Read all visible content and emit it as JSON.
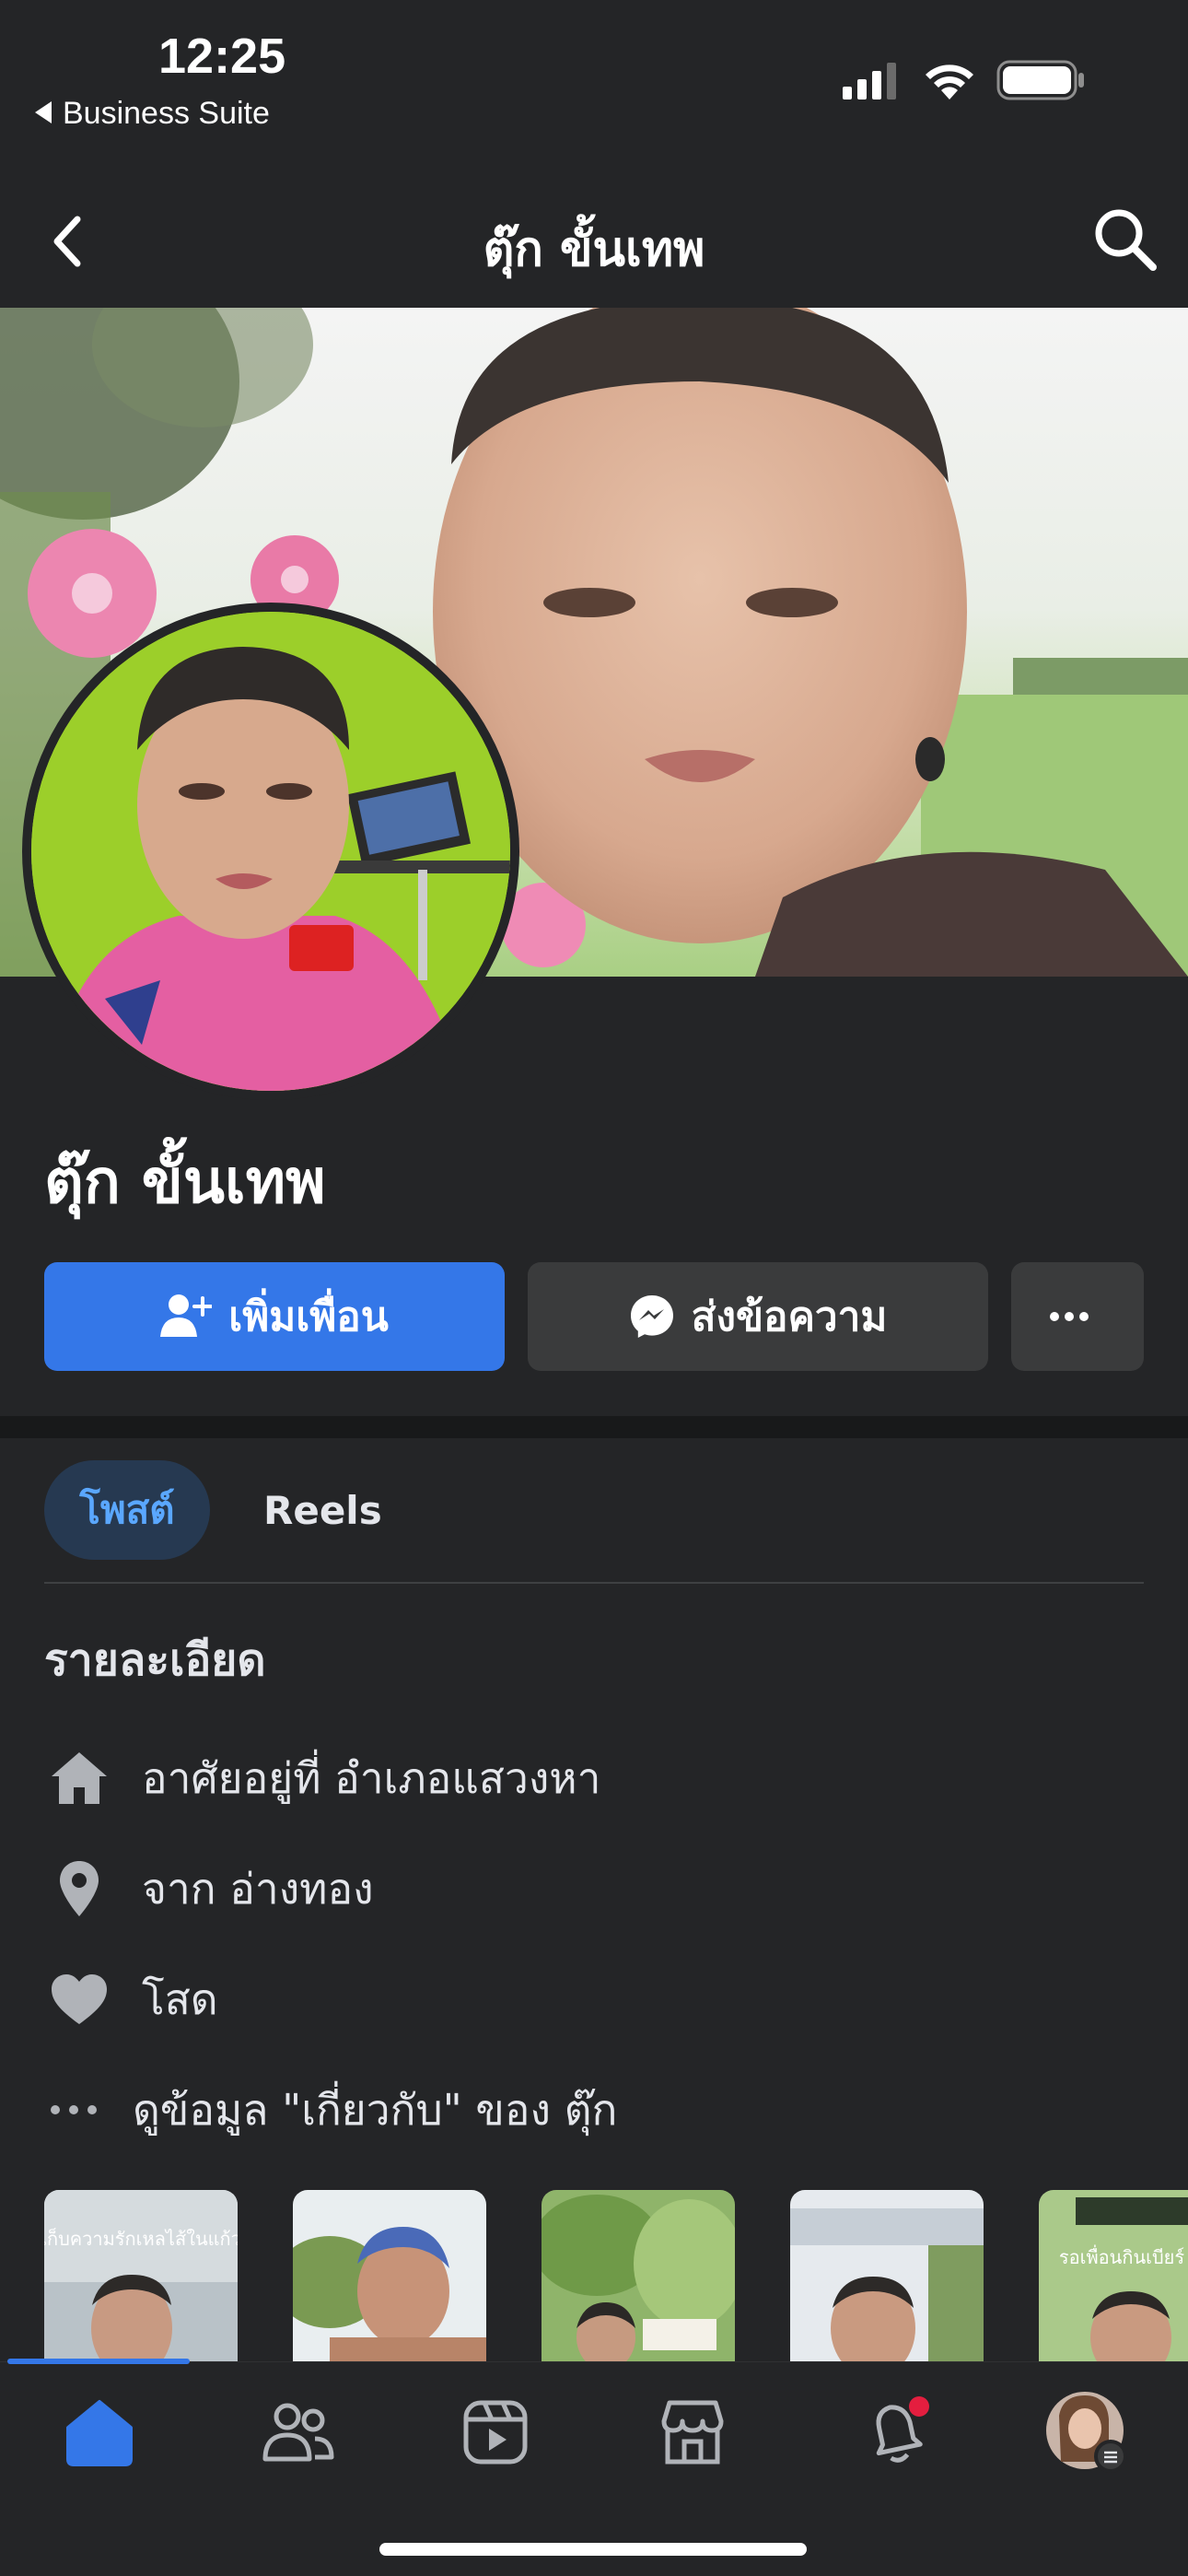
{
  "status_bar": {
    "time": "12:25",
    "back_app": "Business Suite"
  },
  "nav": {
    "title": "ตุ๊ก ขั้นเทพ",
    "back_icon": "chevron-left-icon",
    "search_icon": "search-icon"
  },
  "profile": {
    "name": "ตุ๊ก ขั้นเทพ"
  },
  "actions": {
    "add_friend": "เพิ่มเพื่อน",
    "message": "ส่งข้อความ",
    "more": "..."
  },
  "tabs": [
    {
      "label": "โพสต์",
      "active": true
    },
    {
      "label": "Reels",
      "active": false
    }
  ],
  "details": {
    "heading": "รายละเอียด",
    "items": [
      {
        "icon": "home-icon",
        "text": "อาศัยอยู่ที่ อำเภอแสวงหา"
      },
      {
        "icon": "location-pin-icon",
        "text": "จาก อ่างทอง"
      },
      {
        "icon": "heart-icon",
        "text": "โสด"
      },
      {
        "icon": "more-dots-icon",
        "text": "ดูข้อมูล \"เกี่ยวกับ\" ของ ตุ๊ก"
      }
    ]
  },
  "photo_strip": {
    "thumb_captions": [
      "เก็บความรักเหลไส้ในแก้ว",
      "",
      "",
      "",
      "รอเพื่อนกินเบียร์"
    ]
  },
  "bottom_nav": [
    {
      "icon": "home-icon",
      "active": true
    },
    {
      "icon": "friends-icon",
      "active": false
    },
    {
      "icon": "video-icon",
      "active": false
    },
    {
      "icon": "marketplace-icon",
      "active": false
    },
    {
      "icon": "notifications-icon",
      "active": false
    },
    {
      "icon": "profile-avatar-icon",
      "active": false
    }
  ],
  "colors": {
    "background": "#242527",
    "accent": "#3477e8",
    "secondary_button": "#3a3b3c",
    "text": "#e4e6eb",
    "active_tab_text": "#5aa7ff",
    "notification_dot": "#e41e3f"
  }
}
